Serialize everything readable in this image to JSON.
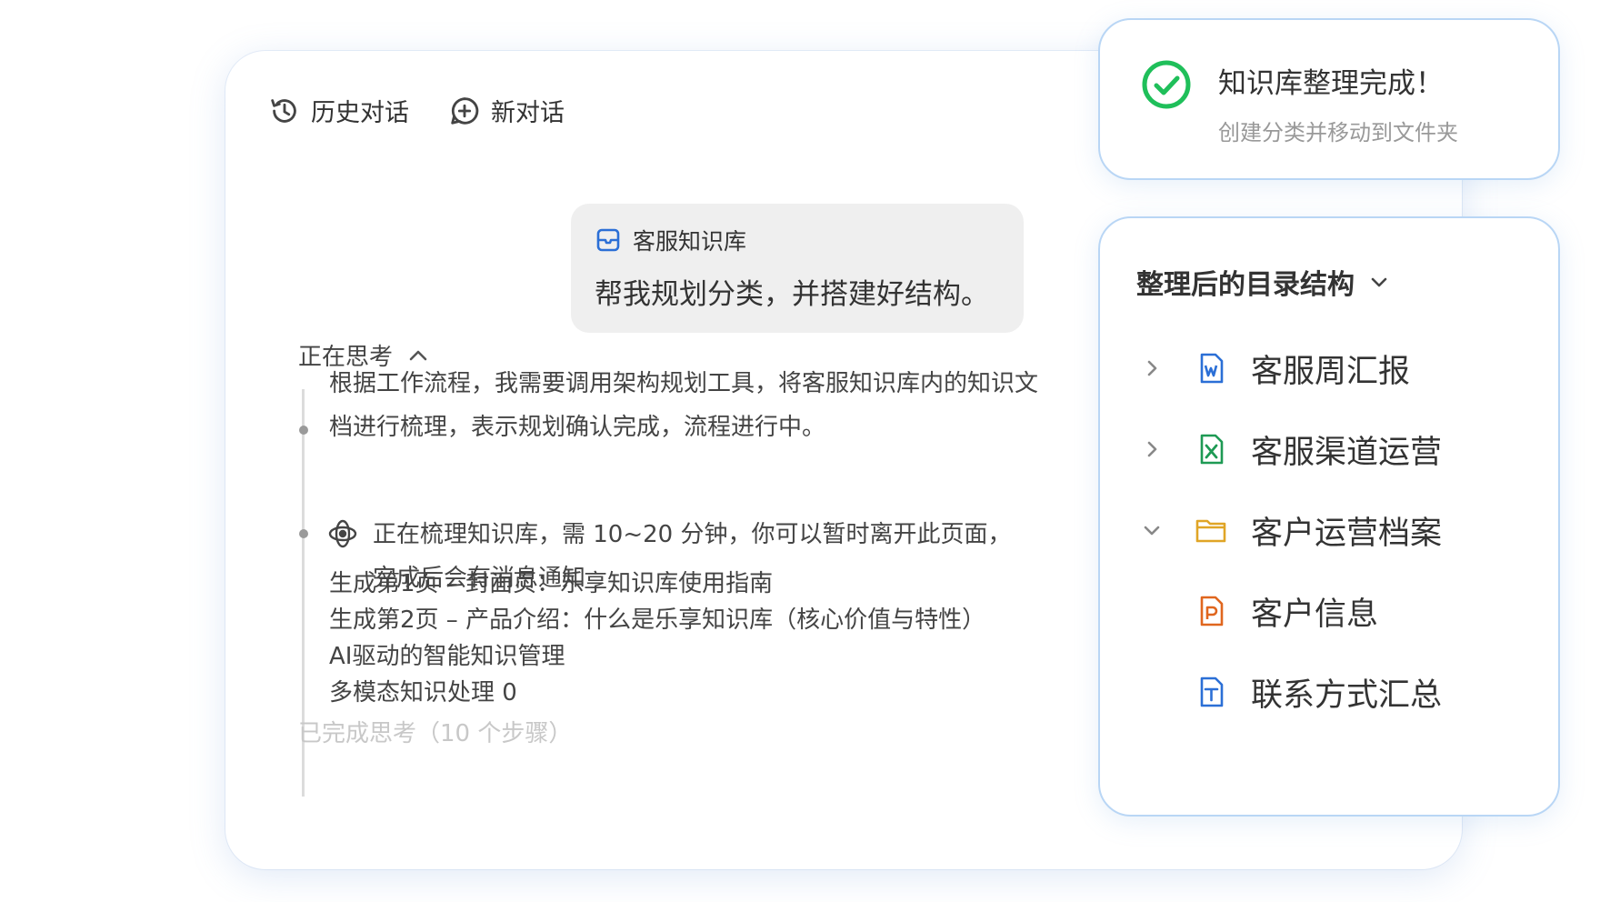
{
  "topbar": {
    "history_label": "历史对话",
    "new_chat_label": "新对话"
  },
  "user_message": {
    "knowledge_base": "客服知识库",
    "text": "帮我规划分类，并搭建好结构。"
  },
  "thinking": {
    "header": "正在思考",
    "step1": "根据工作流程，我需要调用架构规划工具，将客服知识库内的知识文档进行梳理，表示规划确认完成，流程进行中。",
    "step2": "正在梳理知识库，需 10~20 分钟，你可以暂时离开此页面，完成后会有消息通知",
    "lines": [
      "生成第1页 – 封面页：乐享知识库使用指南",
      "生成第2页 – 产品介绍：什么是乐享知识库（核心价值与特性）",
      "AI驱动的智能知识管理",
      "多模态知识处理 0"
    ],
    "completed": "已完成思考（10 个步骤）"
  },
  "notice": {
    "title": "知识库整理完成！",
    "subtitle": "创建分类并移动到文件夹",
    "icon": "check-circle-icon",
    "color": "#1fbf5a"
  },
  "tree": {
    "title": "整理后的目录结构",
    "items": [
      {
        "label": "客服周汇报",
        "icon": "word-doc-icon",
        "color": "#2b6fd6",
        "chevron": "right"
      },
      {
        "label": "客服渠道运营",
        "icon": "excel-doc-icon",
        "color": "#1e9a54",
        "chevron": "right"
      },
      {
        "label": "客户运营档案",
        "icon": "folder-icon",
        "color": "#e0a526",
        "chevron": "down"
      },
      {
        "label": "客户信息",
        "icon": "ppt-doc-icon",
        "color": "#e0661e",
        "chevron": "none"
      },
      {
        "label": "联系方式汇总",
        "icon": "text-doc-icon",
        "color": "#2b6fd6",
        "chevron": "none"
      }
    ]
  }
}
